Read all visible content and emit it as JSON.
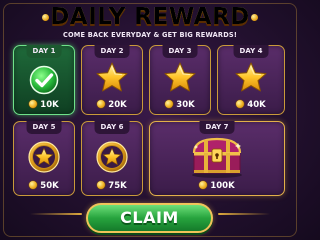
{
  "title": "DAILY REWARD",
  "subtitle": "COME BACK EVERYDAY & GET BIG REWARDS!",
  "claim_label": "CLAIM",
  "colors": {
    "gold": "#ffd24a",
    "card": "#4a2358",
    "claimed": "#1f6a3a",
    "button": "#27a43e"
  },
  "days": [
    {
      "label": "DAY 1",
      "reward": "10K",
      "icon": "checkmark-icon",
      "status": "claimed"
    },
    {
      "label": "DAY 2",
      "reward": "20K",
      "icon": "star-icon",
      "status": "locked"
    },
    {
      "label": "DAY 3",
      "reward": "30K",
      "icon": "star-icon",
      "status": "locked"
    },
    {
      "label": "DAY 4",
      "reward": "40K",
      "icon": "star-icon",
      "status": "locked"
    },
    {
      "label": "DAY 5",
      "reward": "50K",
      "icon": "star-badge-icon",
      "status": "locked"
    },
    {
      "label": "DAY 6",
      "reward": "75K",
      "icon": "star-badge-icon",
      "status": "locked"
    },
    {
      "label": "DAY 7",
      "reward": "100K",
      "icon": "treasure-chest-icon",
      "status": "locked"
    }
  ]
}
